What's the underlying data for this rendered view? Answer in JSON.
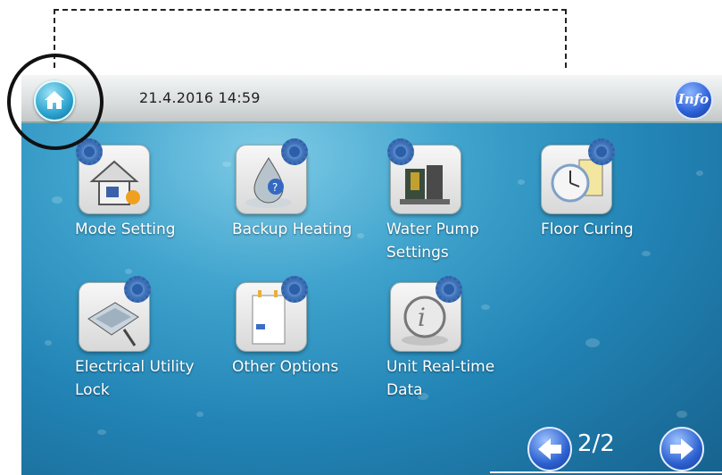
{
  "header": {
    "datetime": "21.4.2016 14:59",
    "info_label": "Info"
  },
  "menu": {
    "items": [
      {
        "id": "mode-setting",
        "label_lines": [
          "Mode Setting"
        ]
      },
      {
        "id": "backup-heating",
        "label_lines": [
          "Backup Heating"
        ]
      },
      {
        "id": "water-pump-settings",
        "label_lines": [
          "Water Pump",
          "Settings"
        ]
      },
      {
        "id": "floor-curing",
        "label_lines": [
          "Floor Curing"
        ]
      },
      {
        "id": "electrical-utility-lock",
        "label_lines": [
          "Electrical Utility",
          "Lock"
        ]
      },
      {
        "id": "other-options",
        "label_lines": [
          "Other Options"
        ]
      },
      {
        "id": "unit-real-time-data",
        "label_lines": [
          "Unit Real-time",
          "Data"
        ]
      }
    ]
  },
  "pagination": {
    "page_indicator": "2/2"
  },
  "colors": {
    "screen_accent": "#2284b5",
    "nav_button": "#2c61d1",
    "topbar": "#d9dddd"
  },
  "icons": [
    "home-icon",
    "info-icon",
    "mode-setting-icon",
    "backup-heating-icon",
    "water-pump-icon",
    "floor-curing-icon",
    "utility-lock-icon",
    "other-options-icon",
    "real-time-data-icon",
    "arrow-left-icon",
    "arrow-right-icon",
    "gear-icon"
  ]
}
